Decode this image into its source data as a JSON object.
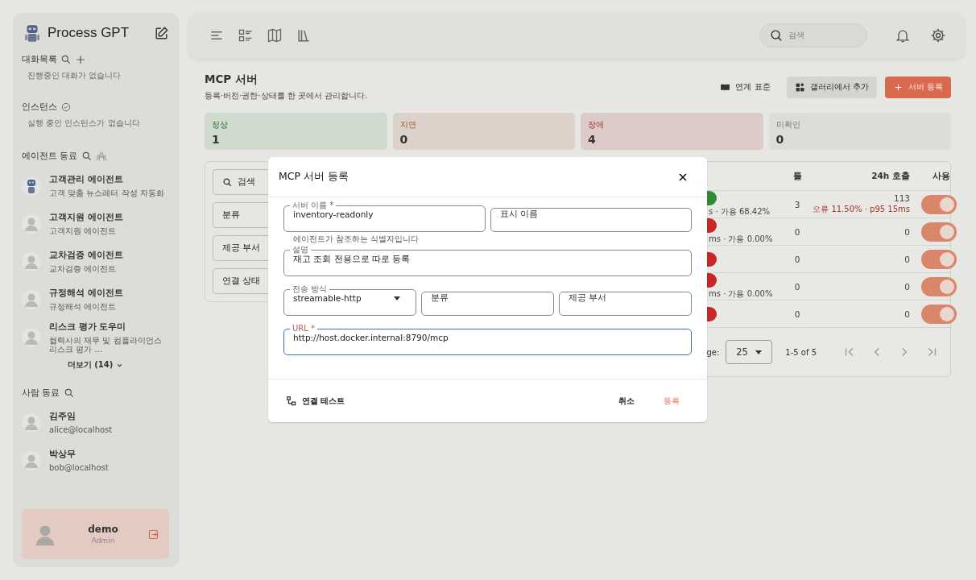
{
  "sidebar": {
    "app_name": "Process GPT",
    "sections": [
      {
        "title": "대화목록",
        "empty_text": "진행중인 대화가 없습니다"
      },
      {
        "title": "인스턴스",
        "empty_text": "실행 중인 인스턴스가 없습니다"
      }
    ],
    "agents_title": "에이전트 동료",
    "agents": [
      {
        "name": "고객관리 에이전트",
        "subtitle": "고객 맞춤 뉴스레터 작성 자동화"
      },
      {
        "name": "고객지원 에이전트",
        "subtitle": "고객지원 에이전트"
      },
      {
        "name": "교차검증 에이전트",
        "subtitle": "교차검증 에이전트"
      },
      {
        "name": "규정해석 에이전트",
        "subtitle": "규정해석 에이전트"
      },
      {
        "name": "리스크 평가 도우미",
        "subtitle": "협력사의 재무 및 컴플라이언스 리스크 평가 ..."
      }
    ],
    "more_button": "더보기 (14)",
    "people_title": "사람 동료",
    "people": [
      {
        "name": "김주임",
        "subtitle": "alice@localhost"
      },
      {
        "name": "박상무",
        "subtitle": "bob@localhost"
      }
    ],
    "user": {
      "name": "demo",
      "role": "Admin"
    }
  },
  "topbar": {
    "search": {
      "placeholder": "검색"
    }
  },
  "page": {
    "title": "MCP 서버",
    "subtitle": "등록·버전·권한·상태를 한 곳에서 관리합니다.",
    "actions": [
      {
        "kind": "text",
        "label": "연계 표준"
      },
      {
        "kind": "tonal",
        "label": "갤러리에서 추가"
      },
      {
        "kind": "primary",
        "label": "서버 등록"
      }
    ],
    "stats": [
      {
        "kind": "ok",
        "label": "정상",
        "value": "1"
      },
      {
        "kind": "slow",
        "label": "지연",
        "value": "0"
      },
      {
        "kind": "fail",
        "label": "장애",
        "value": "4"
      },
      {
        "kind": "unknown",
        "label": "미확인",
        "value": "0"
      }
    ],
    "filters": [
      {
        "kind": "search",
        "label": "검색"
      },
      {
        "kind": "select",
        "label": "분류"
      },
      {
        "kind": "select",
        "label": "제공 부서"
      },
      {
        "kind": "select",
        "label": "연결 상태"
      }
    ],
    "table": {
      "columns": [
        "툴",
        "24h 호출",
        "사용"
      ],
      "rows": [
        {
          "color": "#2e8b32",
          "status_text": "s · 가용 68.42%",
          "tools": "3",
          "calls": "113",
          "calls_detail": "오류 11.50% · p95 15ms",
          "on": true
        },
        {
          "color": "#c62828",
          "status_text": "ms · 가용 0.00%",
          "tools": "0",
          "calls": "0",
          "on": true
        },
        {
          "color": "#c62828",
          "tools": "0",
          "calls": "0",
          "on": true
        },
        {
          "color": "#c62828",
          "status_text": "ms · 가용 0.00%",
          "tools": "0",
          "calls": "0",
          "on": true
        },
        {
          "color": "#c62828",
          "tools": "0",
          "calls": "0",
          "on": true
        }
      ],
      "pagination": {
        "per_page_label": "ge:",
        "per_page": "25",
        "range": "1-5 of 5"
      }
    }
  },
  "dialog": {
    "title": "MCP 서버 등록",
    "rows": [
      [
        {
          "kind": "text",
          "label": "서버 이름 *",
          "value": "inventory-readonly",
          "hint": "에이전트가 참조하는 식별자입니다"
        },
        {
          "kind": "text",
          "placeholder": "표시 이름"
        }
      ],
      [
        {
          "kind": "text",
          "label": "설명",
          "value": "재고 조회 전용으로 따로 등록"
        }
      ],
      [
        {
          "kind": "select",
          "label": "전송 방식",
          "value": "streamable-http"
        },
        {
          "kind": "text",
          "placeholder": "분류"
        },
        {
          "kind": "text",
          "placeholder": "제공 부서"
        }
      ],
      [
        {
          "kind": "text",
          "label": "URL *",
          "value": "http://host.docker.internal:8790/mcp",
          "focused": true
        }
      ]
    ],
    "test_button": "연결 테스트",
    "cancel_button": "취소",
    "submit_button": "등록"
  }
}
